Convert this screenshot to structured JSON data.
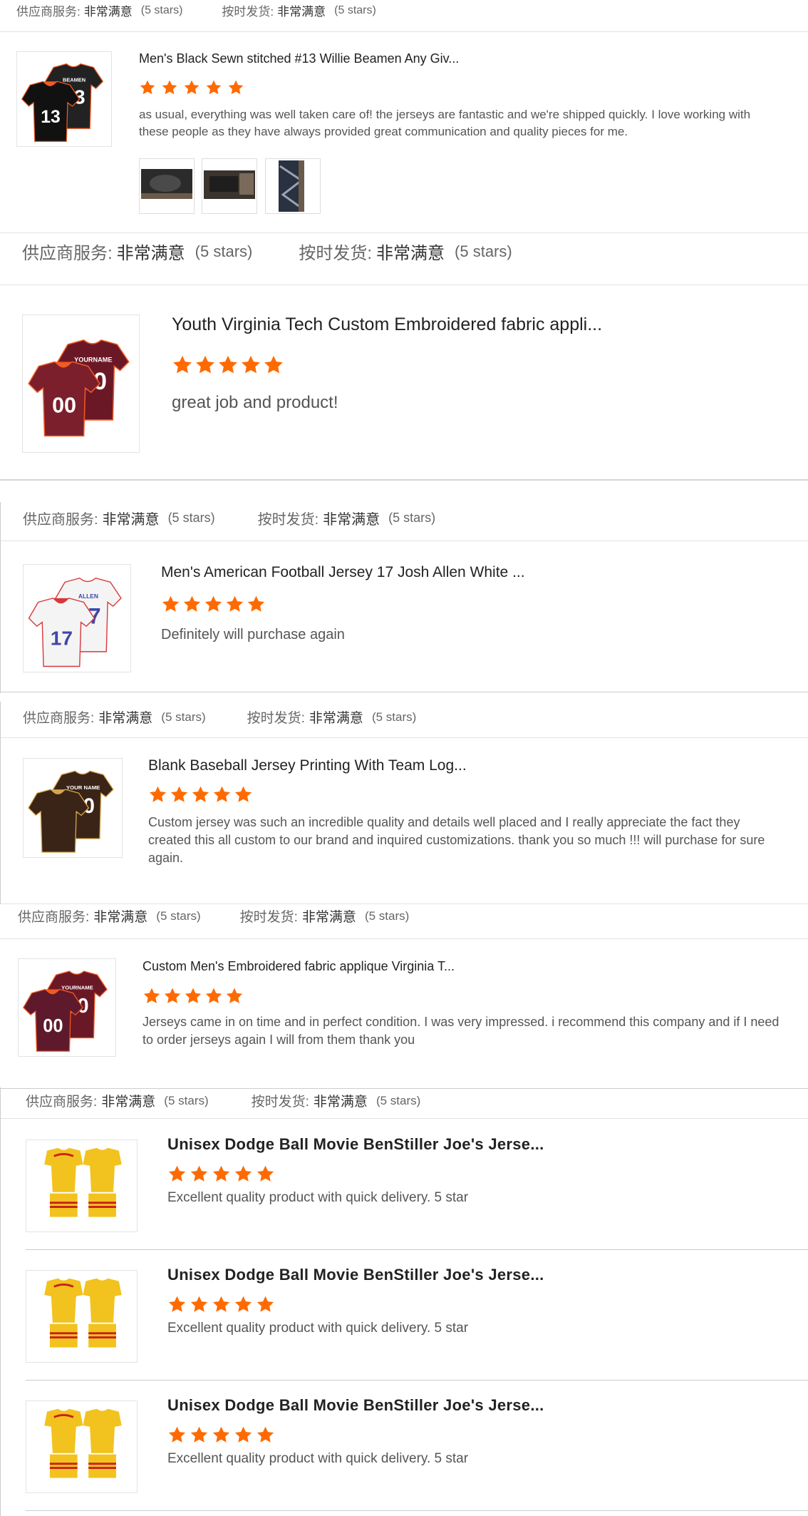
{
  "labels": {
    "supplier_service": "供应商服务:",
    "on_time_delivery": "按时发货:",
    "very_satisfied": "非常满意",
    "five_stars": "(5 stars)"
  },
  "colors": {
    "star": "#ff6a00",
    "divider": "#e2e2e2"
  },
  "reviews": [
    {
      "product_title": "Men's Black Sewn stitched #13 Willie Beamen Any Giv...",
      "rating": 5,
      "text": "as usual, everything was well taken care of! the jerseys are fantastic and we're shipped quickly. I love working with these people as they have always provided great communication and quality pieces for me.",
      "photo_count": 3,
      "jersey": {
        "colors": [
          "#111111",
          "#222222"
        ],
        "numbers": [
          "13",
          "13"
        ],
        "name": "BEAMEN"
      }
    },
    {
      "product_title": "Youth Virginia Tech Custom Embroidered fabric appli...",
      "rating": 5,
      "text": "great job and product!",
      "jersey": {
        "colors": [
          "#7a1f2b",
          "#6b1826"
        ],
        "numbers": [
          "00",
          "00"
        ],
        "name": "YOURNAME"
      }
    },
    {
      "product_title": "Men's American Football Jersey 17 Josh Allen White ...",
      "rating": 5,
      "text": "Definitely will purchase again",
      "jersey": {
        "colors": [
          "#f4f4f4",
          "#f4f4f4"
        ],
        "numbers": [
          "17",
          "17"
        ],
        "name": "ALLEN"
      }
    },
    {
      "product_title": "Blank Baseball Jersey Printing With Team Log...",
      "rating": 5,
      "text": "Custom jersey was such an incredible quality and details well placed and I really appreciate the fact they created this all custom to our brand and inquired customizations. thank you so much !!! will purchase for sure again.",
      "jersey": {
        "colors": [
          "#3a2418",
          "#3a2418"
        ],
        "numbers": [
          "",
          "00"
        ],
        "name": "YOUR NAME"
      }
    },
    {
      "product_title": "Custom Men's Embroidered fabric applique Virginia T...",
      "rating": 5,
      "text": "Jerseys came in on time and in perfect condition. I was very impressed. i recommend this company and if I need to order jerseys again I will from them thank you",
      "jersey": {
        "colors": [
          "#5e1a2c",
          "#6b1826"
        ],
        "numbers": [
          "00",
          "00"
        ],
        "name": "YOURNAME"
      }
    },
    {
      "product_title": "Unisex Dodge Ball Movie BenStiller Joe's Jerse...",
      "rating": 5,
      "text": "Excellent quality product with quick delivery. 5 star",
      "jersey": {
        "colors": [
          "#f2c21f",
          "#f2c21f"
        ],
        "numbers": [
          "",
          ""
        ],
        "name": ""
      }
    },
    {
      "product_title": "Unisex Dodge Ball Movie BenStiller Joe's Jerse...",
      "rating": 5,
      "text": "Excellent quality product with quick delivery. 5 star",
      "jersey": {
        "colors": [
          "#f2c21f",
          "#f2c21f"
        ],
        "numbers": [
          "",
          ""
        ],
        "name": ""
      }
    },
    {
      "product_title": "Unisex Dodge Ball Movie BenStiller Joe's Jerse...",
      "rating": 5,
      "text": "Excellent quality product with quick delivery. 5 star",
      "jersey": {
        "colors": [
          "#f2c21f",
          "#f2c21f"
        ],
        "numbers": [
          "",
          ""
        ],
        "name": ""
      }
    }
  ]
}
